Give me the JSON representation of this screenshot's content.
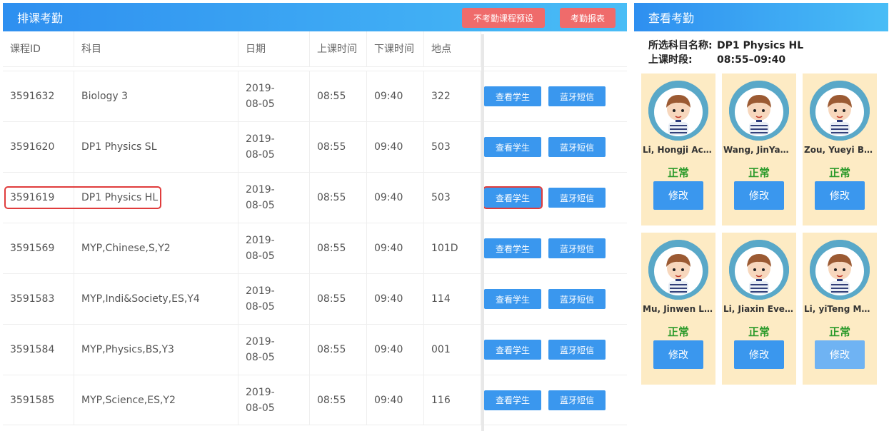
{
  "left": {
    "title": "排课考勤",
    "preset_btn": "不考勤课程预设",
    "report_btn": "考勤报表",
    "columns": [
      "课程ID",
      "科目",
      "日期",
      "上课时间",
      "下课时间",
      "地点"
    ],
    "rows": [
      {
        "id": "3591632",
        "subject": "Biology 3",
        "date": "2019-08-05",
        "start": "08:55",
        "end": "09:40",
        "room": "322",
        "view": "查看学生",
        "sms": "蓝牙短信"
      },
      {
        "id": "3591620",
        "subject": "DP1 Physics SL",
        "date": "2019-08-05",
        "start": "08:55",
        "end": "09:40",
        "room": "503",
        "view": "查看学生",
        "sms": "蓝牙短信"
      },
      {
        "id": "3591619",
        "subject": "DP1 Physics HL",
        "date": "2019-08-05",
        "start": "08:55",
        "end": "09:40",
        "room": "503",
        "view": "查看学生",
        "sms": "蓝牙短信"
      },
      {
        "id": "3591569",
        "subject": "MYP,Chinese,S,Y2",
        "date": "2019-08-05",
        "start": "08:55",
        "end": "09:40",
        "room": "101D",
        "view": "查看学生",
        "sms": "蓝牙短信"
      },
      {
        "id": "3591583",
        "subject": "MYP,Indi&Society,ES,Y4",
        "date": "2019-08-05",
        "start": "08:55",
        "end": "09:40",
        "room": "114",
        "view": "查看学生",
        "sms": "蓝牙短信"
      },
      {
        "id": "3591584",
        "subject": "MYP,Physics,BS,Y3",
        "date": "2019-08-05",
        "start": "08:55",
        "end": "09:40",
        "room": "001",
        "view": "查看学生",
        "sms": "蓝牙短信"
      },
      {
        "id": "3591585",
        "subject": "MYP,Science,ES,Y2",
        "date": "2019-08-05",
        "start": "08:55",
        "end": "09:40",
        "room": "116",
        "view": "查看学生",
        "sms": "蓝牙短信"
      }
    ]
  },
  "right": {
    "title": "查看考勤",
    "subject_label": "所选科目名称:",
    "subject_value": "DP1 Physics HL",
    "period_label": "上课时段:",
    "period_value": "08:55–09:40",
    "students": [
      {
        "name": "Li, Hongji Acc...",
        "status": "正常",
        "edit": "修改"
      },
      {
        "name": "Wang, JinYan...",
        "status": "正常",
        "edit": "修改"
      },
      {
        "name": "Zou, Yueyi Be...",
        "status": "正常",
        "edit": "修改"
      },
      {
        "name": "Mu, Jinwen Li...",
        "status": "正常",
        "edit": "修改"
      },
      {
        "name": "Li, Jiaxin Evel...",
        "status": "正常",
        "edit": "修改"
      },
      {
        "name": "Li, yiTeng Ma...",
        "status": "正常",
        "edit": "修改"
      }
    ]
  },
  "colors": {
    "header_start": "#2e8ff0",
    "header_end": "#49bdf6",
    "red_btn": "#ef6b6b",
    "blue_btn": "#3a97ee",
    "card_bg": "#fdebc4",
    "status_green": "#2b9a2b",
    "highlight": "#e03c3c"
  }
}
